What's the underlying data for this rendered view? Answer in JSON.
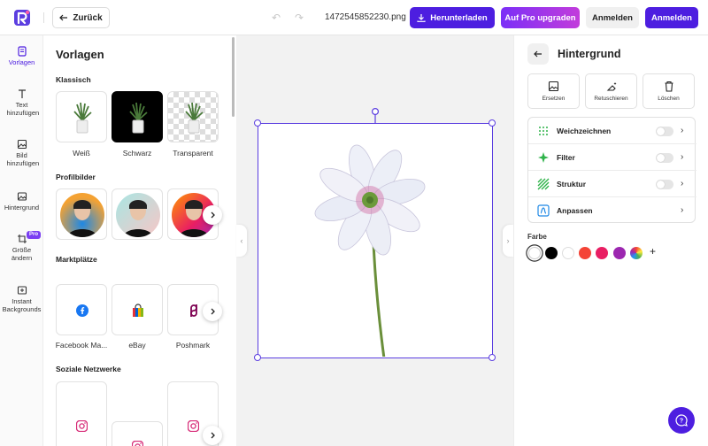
{
  "header": {
    "back_label": "Zurück",
    "filename": "1472545852230.png",
    "download_label": "Herunterladen",
    "pro_label": "Auf Pro upgraden",
    "login_label": "Anmelden",
    "signup_label": "Anmelden"
  },
  "rail": {
    "items": [
      {
        "label": "Vorlagen",
        "icon": "templates-icon"
      },
      {
        "label": "Text hinzufügen",
        "icon": "text-icon"
      },
      {
        "label": "Bild hinzufügen",
        "icon": "image-icon"
      },
      {
        "label": "Hintergrund",
        "icon": "background-icon"
      },
      {
        "label": "Größe ändern",
        "icon": "crop-icon",
        "badge": "Pro"
      },
      {
        "label": "Instant Backgrounds",
        "icon": "instant-bg-icon"
      }
    ]
  },
  "templates": {
    "title": "Vorlagen",
    "sections": [
      {
        "title": "Klassisch",
        "items": [
          "Weiß",
          "Schwarz",
          "Transparent"
        ]
      },
      {
        "title": "Profilbilder",
        "items": []
      },
      {
        "title": "Marktplätze",
        "items": [
          "Facebook Ma...",
          "eBay",
          "Poshmark"
        ]
      },
      {
        "title": "Soziale Netzwerke",
        "items": []
      }
    ]
  },
  "right_panel": {
    "title": "Hintergrund",
    "tools": [
      "Ersetzen",
      "Retuschieren",
      "Löschen"
    ],
    "options": [
      {
        "label": "Weichzeichnen",
        "toggle": false
      },
      {
        "label": "Filter",
        "toggle": false
      },
      {
        "label": "Struktur",
        "toggle": false
      },
      {
        "label": "Anpassen"
      }
    ],
    "color_label": "Farbe",
    "colors": [
      "#ffffff",
      "#000000",
      "#ffffff",
      "#f44336",
      "#e91e63",
      "#9c27b0",
      "multicolor"
    ]
  },
  "accent_color": "#4d1ee0"
}
